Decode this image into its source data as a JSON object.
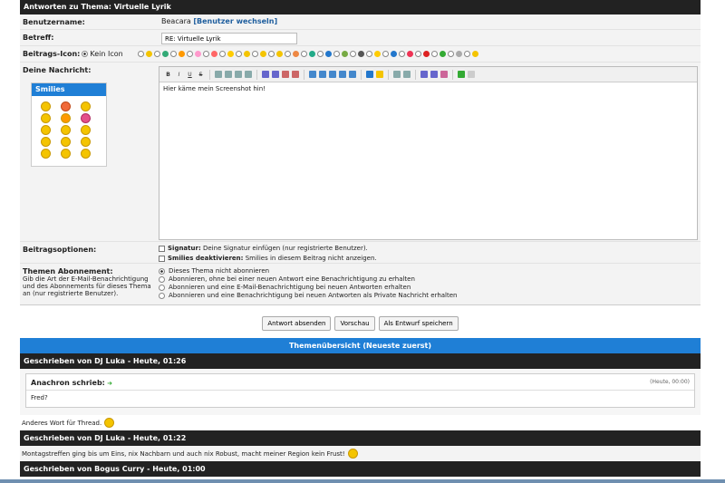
{
  "form": {
    "title": "Antworten zu Thema: Virtuelle Lyrik",
    "username_label": "Benutzername:",
    "username_value": "Beacara",
    "switch_user": "[Benutzer wechseln]",
    "subject_label": "Betreff:",
    "subject_value": "RE: Virtuelle Lyrik",
    "icon_label": "Beitrags-Icon:",
    "no_icon": "Kein Icon",
    "message_label": "Deine Nachricht:",
    "smilies_title": "Smilies",
    "message_text": "Hier käme mein Screenshot hin!",
    "toolbar": [
      "B",
      "I",
      "U",
      "S"
    ],
    "options_label": "Beitragsoptionen:",
    "signature_bold": "Signatur:",
    "signature_text": "Deine Signatur einfügen (nur registrierte Benutzer).",
    "smilies_bold": "Smilies deaktivieren:",
    "smilies_text": "Smilies in diesem Beitrag nicht anzeigen.",
    "subscription_label": "Themen Abonnement:",
    "subscription_desc": "Gib die Art der E-Mail-Benachrichtigung und des Abonnements für dieses Thema an (nur registrierte Benutzer).",
    "subscription_options": [
      "Dieses Thema nicht abonnieren",
      "Abonnieren, ohne bei einer neuen Antwort eine Benachrichtigung zu erhalten",
      "Abonnieren und eine E-Mail-Benachrichtigung bei neuen Antworten erhalten",
      "Abonnieren und eine Benachrichtigung bei neuen Antworten als Private Nachricht erhalten"
    ],
    "buttons": {
      "submit": "Antwort absenden",
      "preview": "Vorschau",
      "draft": "Als Entwurf speichern"
    }
  },
  "review": {
    "title": "Themenübersicht (Neueste zuerst)",
    "posts": [
      {
        "header": "Geschrieben von DJ Luka - Heute, 01:26",
        "quote_author": "Anachron schrieb:",
        "quote_time": "(Heute, 00:00)",
        "quote_text": "Fred?",
        "text": "Anderes Wort für Thread."
      },
      {
        "header": "Geschrieben von DJ Luka - Heute, 01:22",
        "text": "Montagstreffen ging bis um Eins, nix Nachbarn und auch nix Robust, macht meiner Region kein Frust!"
      },
      {
        "header": "Geschrieben von Bogus Curry - Heute, 01:00"
      }
    ]
  },
  "colors": {
    "header_dark": "#222222",
    "accent_blue": "#1f7fd6",
    "link": "#1e5e9e"
  }
}
